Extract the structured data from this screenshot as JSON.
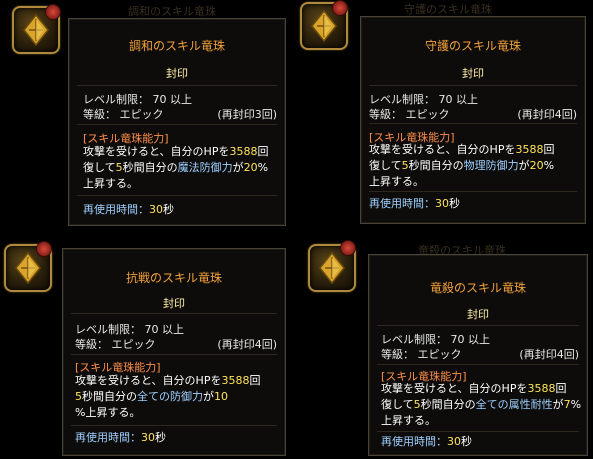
{
  "tooltips": [
    {
      "bg_title": "調和のスキル竜珠",
      "title": "調和のスキル竜珠",
      "seal": "封印",
      "level_label": "レベル制限：",
      "level_value": "70 以上",
      "grade_label": "等級：",
      "grade_value": "エピック",
      "reseal": "(再封印3回)",
      "ability_header": "[スキル竜珠能力]",
      "desc1_a": "攻撃を受けると、自分のHPを",
      "desc1_n": "3588",
      "desc1_b": "回",
      "desc2_a": "復して",
      "desc2_n": "5",
      "desc2_b": "秒間自分の",
      "desc2_stat": "魔法防御力",
      "desc2_c": "が",
      "desc2_p": "20",
      "desc2_d": "%",
      "desc3": "上昇する。",
      "cool_label": "再使用時間：",
      "cool_value": "30",
      "cool_unit": "秒"
    },
    {
      "bg_title": "守護のスキル竜珠",
      "title": "守護のスキル竜珠",
      "seal": "封印",
      "level_label": "レベル制限：",
      "level_value": "70 以上",
      "grade_label": "等級：",
      "grade_value": "エピック",
      "reseal": "(再封印4回)",
      "ability_header": "[スキル竜珠能力]",
      "desc1_a": "攻撃を受けると、自分のHPを",
      "desc1_n": "3588",
      "desc1_b": "回",
      "desc2_a": "復して",
      "desc2_n": "5",
      "desc2_b": "秒間自分の",
      "desc2_stat": "物理防御力",
      "desc2_c": "が",
      "desc2_p": "20",
      "desc2_d": "%",
      "desc3": "上昇する。",
      "cool_label": "再使用時間：",
      "cool_value": "30",
      "cool_unit": "秒"
    },
    {
      "bg_title": "",
      "title": "抗戦のスキル竜珠",
      "seal": "封印",
      "level_label": "レベル制限：",
      "level_value": "70 以上",
      "grade_label": "等級：",
      "grade_value": "エピック",
      "reseal": "(再封印4回)",
      "ability_header": "[スキル竜珠能力]",
      "desc1_a": "攻撃を受けると、自分のHPを",
      "desc1_n": "3588",
      "desc1_b": "回",
      "desc2_a": "復して",
      "desc2_n": "5",
      "desc2_b": "秒間自分の",
      "desc2_stat": "全ての防御力",
      "desc2_c": "が",
      "desc2_p": "10",
      "desc2_d": "",
      "desc3": "%上昇する。",
      "cool_label": "再使用時間：",
      "cool_value": "30",
      "cool_unit": "秒"
    },
    {
      "bg_title": "竜殺のスキル竜珠",
      "title": "竜殺のスキル竜珠",
      "seal": "封印",
      "level_label": "レベル制限：",
      "level_value": "70 以上",
      "grade_label": "等級：",
      "grade_value": "エピック",
      "reseal": "(再封印4回)",
      "ability_header": "[スキル竜珠能力]",
      "desc1_a": "攻撃を受けると、自分のHPを",
      "desc1_n": "3588",
      "desc1_b": "回",
      "desc2_a": "復して",
      "desc2_n": "5",
      "desc2_b": "秒間自分の",
      "desc2_stat": "全ての属性耐性",
      "desc2_c": "が",
      "desc2_p": "7",
      "desc2_d": "%",
      "desc3": "上昇する。",
      "cool_label": "再使用時間：",
      "cool_value": "30",
      "cool_unit": "秒"
    }
  ],
  "colors": {
    "title": "#f2a13a",
    "seal": "#fff1a6",
    "header": "#ff8f4a",
    "highlight_number": "#ffe45a",
    "highlight_stat": "#9fd0ff"
  },
  "icons": [
    "dragon-jewel-icon",
    "seal-badge-icon"
  ]
}
